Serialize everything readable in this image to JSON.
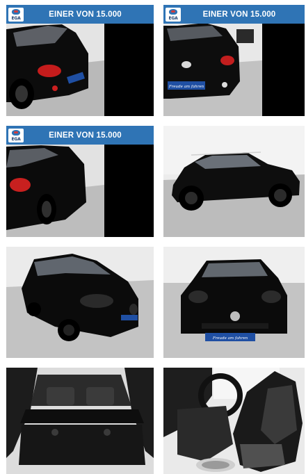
{
  "banner": {
    "logo_text": "EGA",
    "text": "EINER VON 15.000"
  },
  "gallery": {
    "photos": [
      {
        "id": 1,
        "subject": "car-rear-left-view",
        "banner": true
      },
      {
        "id": 2,
        "subject": "car-rear-view",
        "banner": true
      },
      {
        "id": 3,
        "subject": "car-rear-left-view-close",
        "banner": true
      },
      {
        "id": 4,
        "subject": "car-side-view",
        "banner": false
      },
      {
        "id": 5,
        "subject": "car-front-left-view",
        "banner": false
      },
      {
        "id": 6,
        "subject": "car-front-view",
        "banner": false
      },
      {
        "id": 7,
        "subject": "car-trunk-interior",
        "banner": false
      },
      {
        "id": 8,
        "subject": "car-driver-seat-interior",
        "banner": false
      }
    ]
  },
  "plate_text": "Freude am fahren"
}
